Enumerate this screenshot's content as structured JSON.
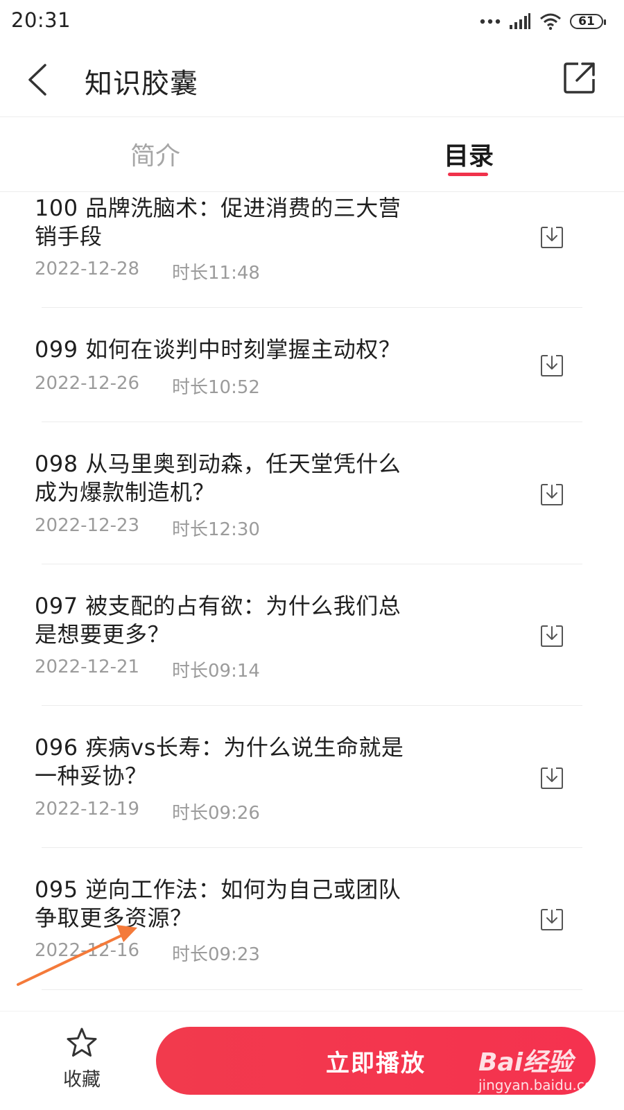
{
  "status_bar": {
    "time": "20:31",
    "battery": "61"
  },
  "header": {
    "title": "知识胶囊"
  },
  "tabs": [
    {
      "label": "简介",
      "active": false
    },
    {
      "label": "目录",
      "active": true
    }
  ],
  "episodes": [
    {
      "title": "100 品牌洗脑术：促进消费的三大营销手段",
      "date": "2022-12-28",
      "duration": "时长11:48"
    },
    {
      "title": "099 如何在谈判中时刻掌握主动权？",
      "date": "2022-12-26",
      "duration": "时长10:52"
    },
    {
      "title": "098 从马里奥到动森，任天堂凭什么成为爆款制造机？",
      "date": "2022-12-23",
      "duration": "时长12:30"
    },
    {
      "title": "097 被支配的占有欲：为什么我们总是想要更多？",
      "date": "2022-12-21",
      "duration": "时长09:14"
    },
    {
      "title": "096 疾病vs长寿：为什么说生命就是一种妥协？",
      "date": "2022-12-19",
      "duration": "时长09:26"
    },
    {
      "title": "095 逆向工作法：如何为自己或团队争取更多资源？",
      "date": "2022-12-16",
      "duration": "时长09:23"
    }
  ],
  "bottom_bar": {
    "favorite_label": "收藏",
    "play_label": "立即播放"
  },
  "watermark": {
    "logo": "Bai经验",
    "url": "jingyan.baidu.com"
  },
  "colors": {
    "accent": "#f0324b",
    "annotation_arrow": "#f47a3a"
  }
}
